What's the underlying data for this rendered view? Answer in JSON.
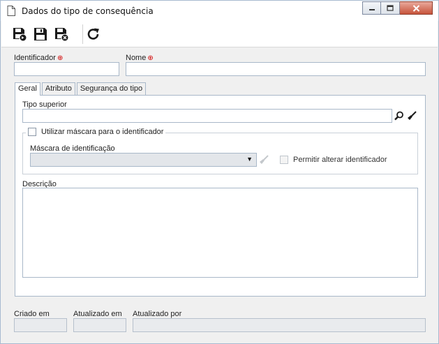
{
  "window": {
    "title": "Dados do tipo de consequência",
    "buttons": [
      "minimize-icon",
      "maximize-icon",
      "close-icon"
    ]
  },
  "toolbar": {
    "items": [
      "save-new-icon",
      "save-icon",
      "save-close-icon",
      "refresh-icon"
    ]
  },
  "form": {
    "identifier_label": "Identificador",
    "identifier_value": "",
    "name_label": "Nome",
    "name_value": "",
    "required_marker": "⊕"
  },
  "tabs": [
    {
      "label": "Geral",
      "active": true
    },
    {
      "label": "Atributo",
      "active": false
    },
    {
      "label": "Segurança do tipo",
      "active": false
    }
  ],
  "general": {
    "parent_type_label": "Tipo superior",
    "parent_type_value": "",
    "use_mask_label": "Utilizar máscara para o identificador",
    "use_mask_checked": false,
    "mask_label": "Máscara de identificação",
    "mask_value": "",
    "allow_change_label": "Permitir alterar identificador",
    "allow_change_checked": false,
    "description_label": "Descrição",
    "description_value": ""
  },
  "footer": {
    "created_label": "Criado em",
    "created_value": "",
    "updated_label": "Atualizado em",
    "updated_value": "",
    "updated_by_label": "Atualizado por",
    "updated_by_value": ""
  }
}
